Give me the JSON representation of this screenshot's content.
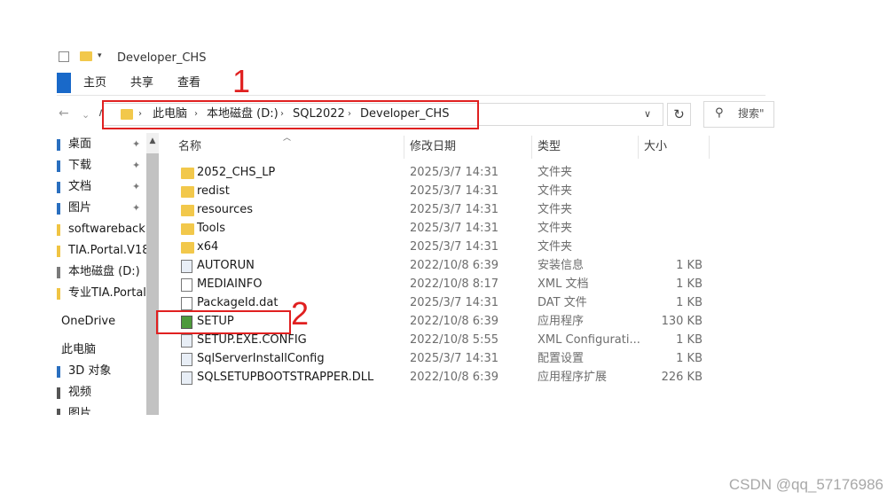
{
  "window": {
    "title": "Developer_CHS"
  },
  "ribbon": {
    "tabs": [
      "主页",
      "共享",
      "查看"
    ]
  },
  "navigation": {
    "breadcrumb": [
      "此电脑",
      "本地磁盘 (D:)",
      "SQL2022",
      "Developer_CHS"
    ],
    "search_placeholder": "搜索\""
  },
  "annotations": [
    "1",
    "2"
  ],
  "sidebar": {
    "items": [
      {
        "label": "桌面",
        "icon": "desktop-icon",
        "pinned": true
      },
      {
        "label": "下载",
        "icon": "download-icon",
        "pinned": true
      },
      {
        "label": "文档",
        "icon": "documents-icon",
        "pinned": true
      },
      {
        "label": "图片",
        "icon": "pictures-icon",
        "pinned": true
      },
      {
        "label": "softwareback",
        "icon": "folder-icon",
        "pinned": false
      },
      {
        "label": "TIA.Portal.V18",
        "icon": "folder-icon",
        "pinned": false
      },
      {
        "label": "本地磁盘 (D:)",
        "icon": "drive-icon",
        "pinned": false
      },
      {
        "label": "专业TIA.Portal.V",
        "icon": "folder-icon",
        "pinned": false
      },
      {
        "label": "OneDrive",
        "icon": "onedrive-icon",
        "pinned": false
      },
      {
        "label": "此电脑",
        "icon": "this-pc-icon",
        "pinned": false
      },
      {
        "label": "3D 对象",
        "icon": "3d-objects-icon",
        "pinned": false
      },
      {
        "label": "视频",
        "icon": "videos-icon",
        "pinned": false
      },
      {
        "label": "图片",
        "icon": "pictures-icon",
        "pinned": false
      }
    ]
  },
  "file_list": {
    "columns": {
      "name": "名称",
      "date": "修改日期",
      "type": "类型",
      "size": "大小"
    },
    "files": [
      {
        "name": "2052_CHS_LP",
        "date": "2025/3/7 14:31",
        "type": "文件夹",
        "size": "",
        "icon": "folder"
      },
      {
        "name": "redist",
        "date": "2025/3/7 14:31",
        "type": "文件夹",
        "size": "",
        "icon": "folder"
      },
      {
        "name": "resources",
        "date": "2025/3/7 14:31",
        "type": "文件夹",
        "size": "",
        "icon": "folder"
      },
      {
        "name": "Tools",
        "date": "2025/3/7 14:31",
        "type": "文件夹",
        "size": "",
        "icon": "folder"
      },
      {
        "name": "x64",
        "date": "2025/3/7 14:31",
        "type": "文件夹",
        "size": "",
        "icon": "folder"
      },
      {
        "name": "AUTORUN",
        "date": "2022/10/8 6:39",
        "type": "安装信息",
        "size": "1 KB",
        "icon": "cfg"
      },
      {
        "name": "MEDIAINFO",
        "date": "2022/10/8 8:17",
        "type": "XML 文档",
        "size": "1 KB",
        "icon": "doc"
      },
      {
        "name": "PackageId.dat",
        "date": "2025/3/7 14:31",
        "type": "DAT 文件",
        "size": "1 KB",
        "icon": "doc"
      },
      {
        "name": "SETUP",
        "date": "2022/10/8 6:39",
        "type": "应用程序",
        "size": "130 KB",
        "icon": "exe"
      },
      {
        "name": "SETUP.EXE.CONFIG",
        "date": "2022/10/8 5:55",
        "type": "XML Configurati...",
        "size": "1 KB",
        "icon": "cfg"
      },
      {
        "name": "SqlServerInstallConfig",
        "date": "2025/3/7 14:31",
        "type": "配置设置",
        "size": "1 KB",
        "icon": "cfg"
      },
      {
        "name": "SQLSETUPBOOTSTRAPPER.DLL",
        "date": "2022/10/8 6:39",
        "type": "应用程序扩展",
        "size": "226 KB",
        "icon": "cfg"
      }
    ]
  },
  "watermark": "CSDN @qq_57176986",
  "colors": {
    "annotation_red": "#e02020",
    "folder_yellow": "#f2c84b",
    "file_tab_blue": "#1969c9"
  }
}
